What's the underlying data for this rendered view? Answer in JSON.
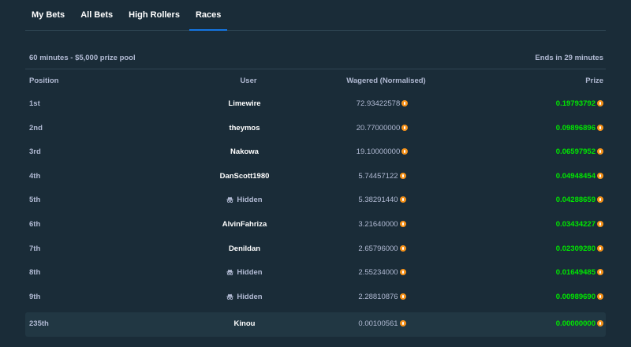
{
  "tabs": [
    {
      "label": "My Bets",
      "active": false
    },
    {
      "label": "All Bets",
      "active": false
    },
    {
      "label": "High Rollers",
      "active": false
    },
    {
      "label": "Races",
      "active": true
    }
  ],
  "race": {
    "description": "60 minutes - $5,000 prize pool",
    "ends": "Ends in 29 minutes"
  },
  "table": {
    "columns": [
      "Position",
      "User",
      "Wagered (Normalised)",
      "Prize"
    ],
    "rows": [
      {
        "position": "1st",
        "user": "Limewire",
        "hidden": false,
        "wagered": "72.93422578",
        "prize": "0.19793792"
      },
      {
        "position": "2nd",
        "user": "theymos",
        "hidden": false,
        "wagered": "20.77000000",
        "prize": "0.09896896"
      },
      {
        "position": "3rd",
        "user": "Nakowa",
        "hidden": false,
        "wagered": "19.10000000",
        "prize": "0.06597952"
      },
      {
        "position": "4th",
        "user": "DanScott1980",
        "hidden": false,
        "wagered": "5.74457122",
        "prize": "0.04948454"
      },
      {
        "position": "5th",
        "user": "Hidden",
        "hidden": true,
        "wagered": "5.38291440",
        "prize": "0.04288659"
      },
      {
        "position": "6th",
        "user": "AlvinFahriza",
        "hidden": false,
        "wagered": "3.21640000",
        "prize": "0.03434227"
      },
      {
        "position": "7th",
        "user": "Denildan",
        "hidden": false,
        "wagered": "2.65796000",
        "prize": "0.02309280"
      },
      {
        "position": "8th",
        "user": "Hidden",
        "hidden": true,
        "wagered": "2.55234000",
        "prize": "0.01649485"
      },
      {
        "position": "9th",
        "user": "Hidden",
        "hidden": true,
        "wagered": "2.28810876",
        "prize": "0.00989690"
      },
      {
        "position": "235th",
        "user": "Kinou",
        "hidden": false,
        "wagered": "0.00100561",
        "prize": "0.00000000",
        "current_user": true
      }
    ]
  },
  "icons": {
    "currency": "bitcoin-icon",
    "hidden_user": "incognito-icon"
  },
  "colors": {
    "background": "#1a2c38",
    "highlight_row": "#213743",
    "accent": "#1475e1",
    "prize_green": "#00e701",
    "coin_orange": "#f7931a",
    "muted_text": "#b1bad3"
  }
}
